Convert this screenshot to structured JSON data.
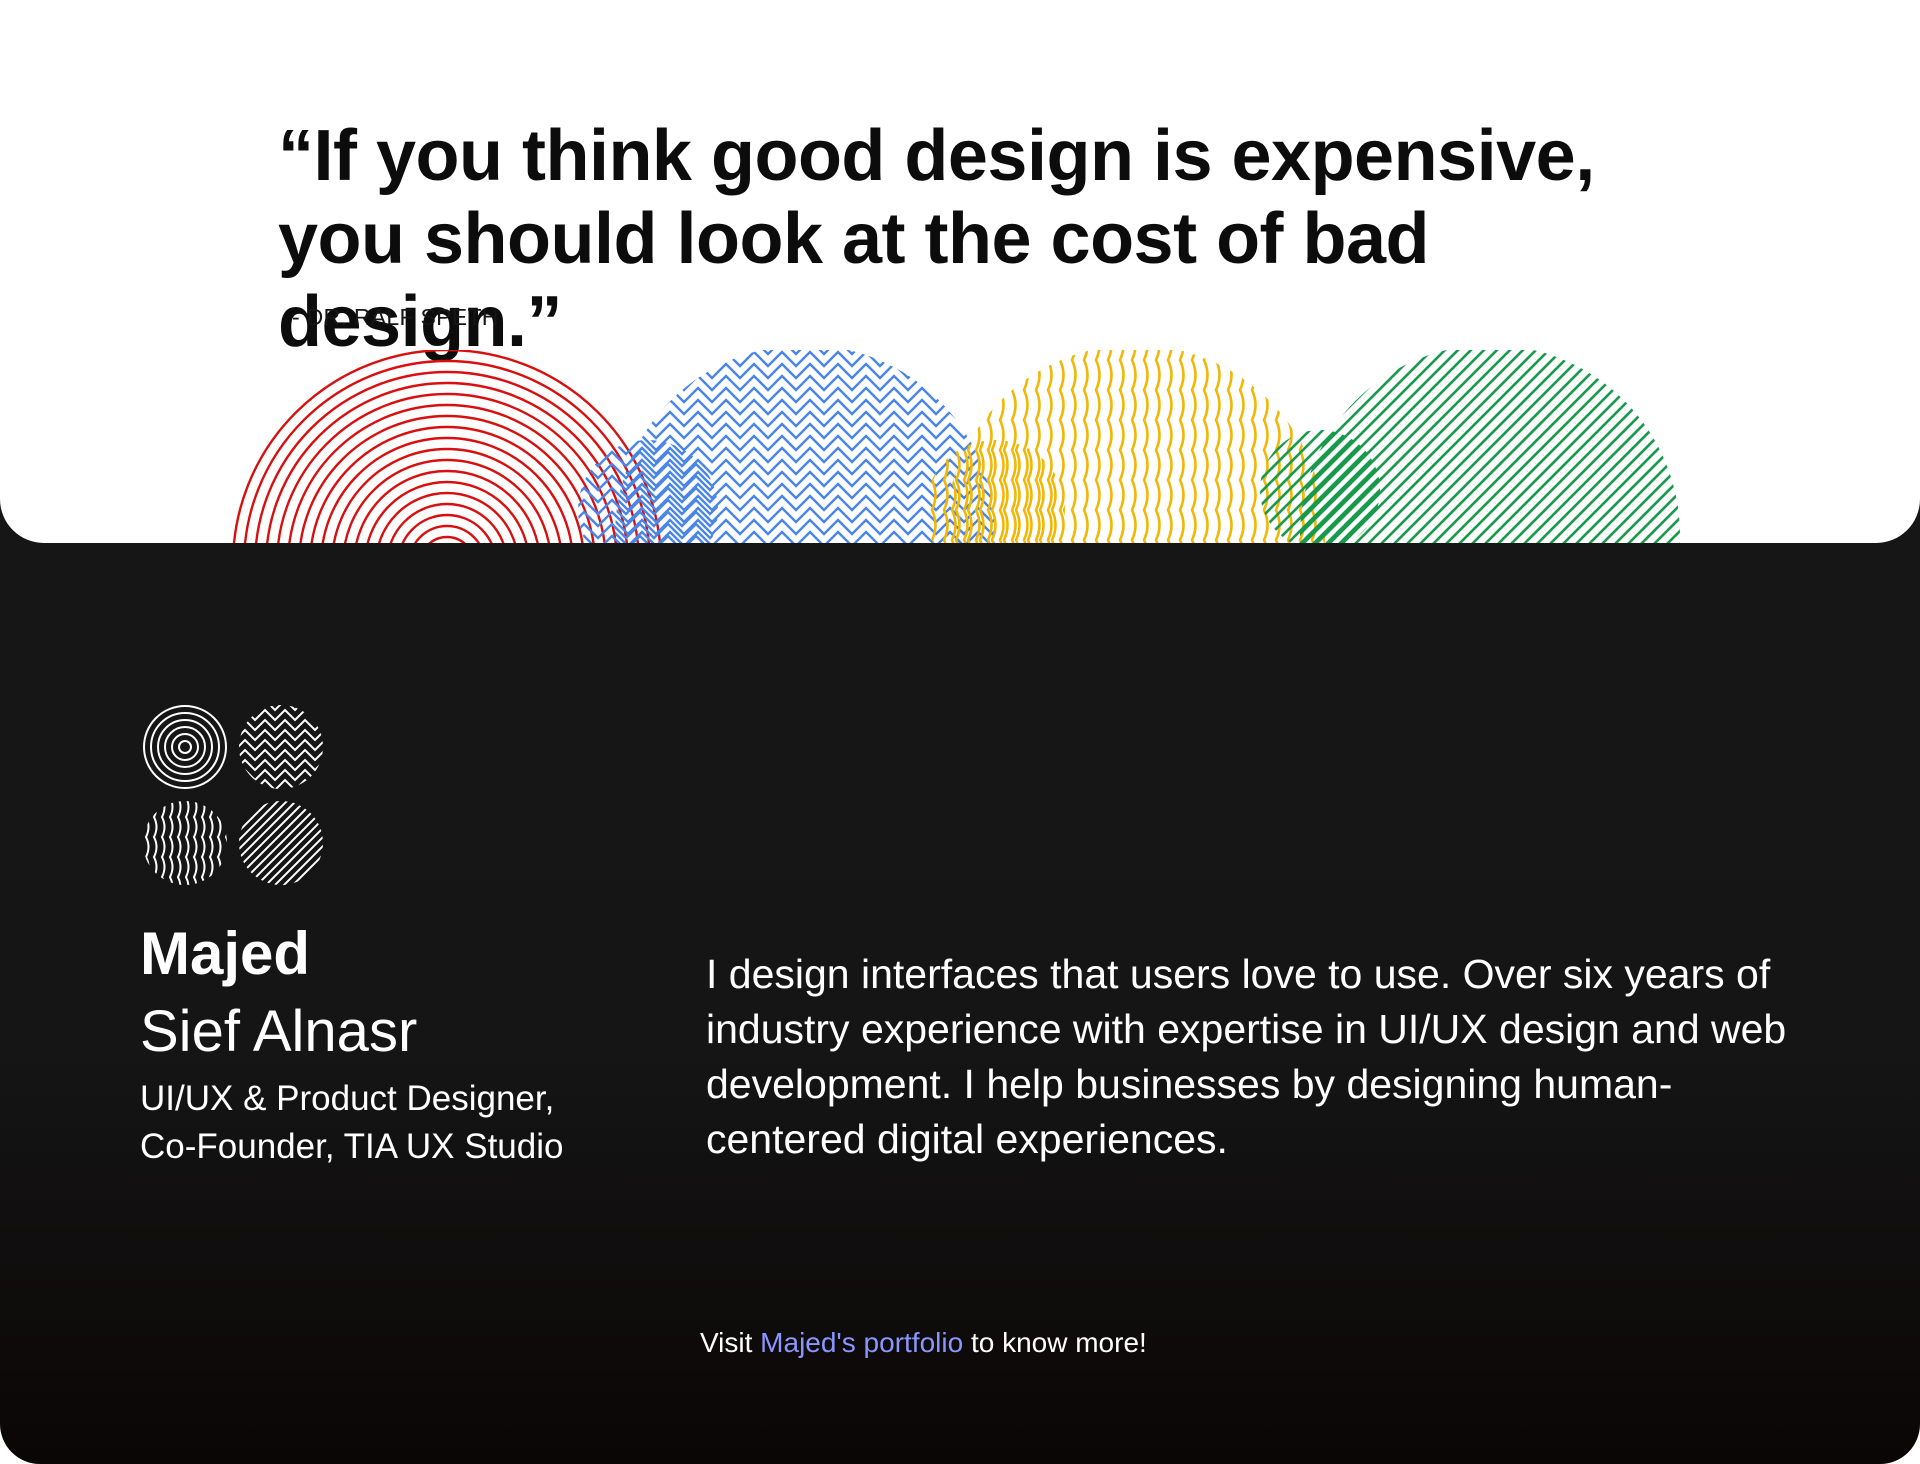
{
  "quote": {
    "text": "“If you think good design is expensive, you should look at the cost of bad design.”",
    "author": "-  DR. RALF SPETH"
  },
  "decor": {
    "colors": {
      "red": "#d90f0f",
      "blue": "#4a86e8",
      "yellow": "#f2b705",
      "green": "#189a4c"
    },
    "icons": [
      "concentric-circles-icon",
      "chevron-pattern-icon",
      "wave-pattern-icon",
      "diagonal-lines-icon"
    ]
  },
  "profile": {
    "first_name": "Majed",
    "last_name": "Sief Alnasr",
    "role_line1": "UI/UX & Product Designer,",
    "role_line2": "Co-Founder, TIA UX Studio",
    "bio": "I design interfaces that users love to use. Over six years of industry experience with expertise in UI/UX design and web development. I help businesses by designing human-centered digital experiences."
  },
  "cta": {
    "prefix": "Visit ",
    "link_label": "Majed's portfolio",
    "suffix": " to know more!",
    "link_color": "#8a96ff"
  }
}
